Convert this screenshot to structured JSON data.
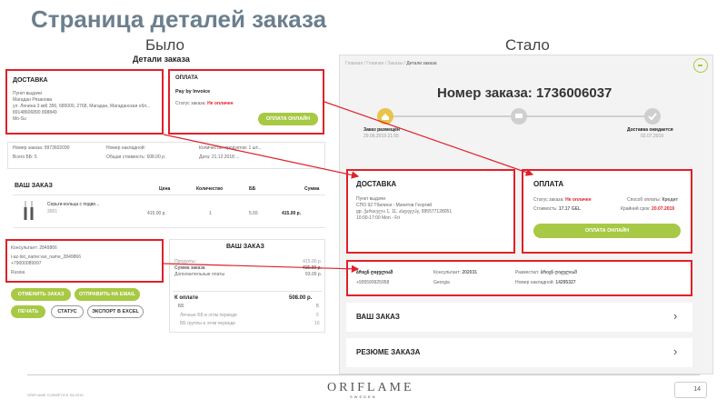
{
  "slide": {
    "title": "Страница деталей заказа",
    "before_label": "Было",
    "after_label": "Стало",
    "page_number": "14",
    "footer_small": "ORIFLAME COSMETICS SA 2019",
    "logo_text": "ORIFLAME",
    "logo_sub": "SWEDEN"
  },
  "old": {
    "page_title": "Детали заказа",
    "delivery": {
      "title": "ДОСТАВКА",
      "lines": [
        "Пункт выдачи",
        "Магадан Рязанова",
        "ул. Ленина 3 кв6 356, 685000, 2768, Магадан, Магаданская обл...",
        "89148606890 898849",
        "Mo-Su"
      ]
    },
    "payment": {
      "title": "ОПЛАТА",
      "method": "Pay by Invoice",
      "status_label": "Статус заказа:",
      "status_value": "Не оплачен",
      "button": "ОПЛАТА ОНЛАЙН"
    },
    "summary": {
      "order_number": "Номер заказа: 9973602090",
      "bv": "Всего ББ: 5",
      "invoice": "Номер накладной:",
      "total_cost": "Общая стоимость: 508.00 р.",
      "items_count": "Количество продуктов: 1 шт...",
      "date": "Дата: 21.12.2018 ..."
    },
    "your_order": {
      "title": "ВАШ ЗАКАЗ",
      "headers": [
        "Цена",
        "Количество",
        "ББ",
        "Сумма"
      ],
      "product_name": "Серьги-кольца с подве...",
      "product_code": "3051",
      "price": "415.00 р.",
      "qty": "1",
      "bv": "5.55",
      "sum": "415.00 р."
    },
    "consultant": {
      "lines": [
        "Консультант: 2849866",
        "i-az-list_name:var_name_2849866",
        "+79000089997",
        "Russia"
      ]
    },
    "buttons": {
      "cancel": "ОТМЕНИТЬ ЗАКАЗ",
      "email": "ОТПРАВИТЬ НА EMAIL",
      "print": "ПЕЧАТЬ",
      "status": "СТАТУС",
      "export": "ЭКСПОРТ В EXCEL"
    },
    "totals": {
      "title": "ВАШ ЗАКАЗ",
      "rows": [
        [
          "Продукты:",
          "415.00 р."
        ],
        [
          "Сумма заказа",
          "415.00 р."
        ],
        [
          "Дополнительные платы",
          "93.00 р."
        ]
      ],
      "to_pay_label": "К оплате",
      "to_pay_value": "508.00 р.",
      "bb_label": "ББ",
      "bb_value": "5",
      "sub_rows": [
        [
          "Личные ББ в этом периоде",
          "5"
        ],
        [
          "ББ группы в этом периоде",
          "10"
        ]
      ]
    }
  },
  "new": {
    "breadcrumb": [
      "Главная",
      "Главная",
      "Заказы",
      "Детали заказа"
    ],
    "order_title": "Номер заказа: 1736006037",
    "progress": {
      "step1_label": "Заказ размещён",
      "step1_date": "29.06.2019 21:55",
      "step3_label": "Доставка ожидается",
      "step3_date": "02.07.2019"
    },
    "delivery": {
      "title": "ДОСТАВКА",
      "lines": [
        "Пункт выдачи",
        "СПО 92 Тбилиси - Мачитов Георгий",
        "gp. ქართული 1, 11, ასდფღჰჯ, 995577128051",
        "10:00-17:00 Mon - Fri"
      ]
    },
    "payment": {
      "title": "ОПЛАТА",
      "status_label": "Статус заказа:",
      "status_value": "Не оплачен",
      "method_label": "Способ оплаты:",
      "method_value": "Кредит",
      "cost_label": "Стоимость:",
      "cost_value": "17.17 GEL",
      "deadline_label": "Крайний срок:",
      "deadline_value": "20.07.2019",
      "button": "ОПЛАТА ОНЛАЙН"
    },
    "consultant": {
      "name": "ბრიენ ღიჯულიაშ",
      "phone": "+995599925958",
      "consultant_label": "Консультант:",
      "consultant_value": "202031",
      "country": "Georgia",
      "placed_label": "Разместил:",
      "placed_value": "ბრიენ ღიჯულიაშ",
      "invoice_label": "Номер накладной:",
      "invoice_value": "14295327"
    },
    "your_order": "ВАШ ЗАКАЗ",
    "summary": "РЕЗЮМЕ ЗАКАЗА"
  },
  "colors": {
    "red": "#e0202a",
    "green": "#a8c945",
    "title": "#6b7f8e"
  }
}
